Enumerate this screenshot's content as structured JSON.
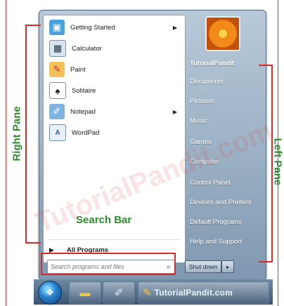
{
  "left_pane": {
    "items": [
      {
        "label": "Getting Started",
        "icon": "getting-started-icon",
        "has_submenu": true
      },
      {
        "label": "Calculator",
        "icon": "calculator-icon",
        "has_submenu": false
      },
      {
        "label": "Paint",
        "icon": "paint-icon",
        "has_submenu": false
      },
      {
        "label": "Solitaire",
        "icon": "solitaire-icon",
        "has_submenu": false
      },
      {
        "label": "Notepad",
        "icon": "notepad-icon",
        "has_submenu": true
      },
      {
        "label": "WordPad",
        "icon": "wordpad-icon",
        "has_submenu": false
      }
    ],
    "all_programs": "All Programs"
  },
  "search": {
    "placeholder": "Search programs and files"
  },
  "right_pane": {
    "items": [
      "TutorialPandit",
      "Documents",
      "Pictures",
      "Music",
      "Games",
      "Computer",
      "Control Panel",
      "Devices and Printers",
      "Default Programs",
      "Help and Support"
    ]
  },
  "shutdown": {
    "label": "Shut down"
  },
  "taskbar": {
    "label": "TutorialPandit.com"
  },
  "annotations": {
    "right_pane": "Right Pane",
    "left_pane": "Left Pane",
    "search_bar": "Search Bar"
  },
  "watermark": "TutorialPandit.com",
  "colors": {
    "annotation_line": "#d32a2a",
    "annotation_text": "#2e8b2e"
  }
}
